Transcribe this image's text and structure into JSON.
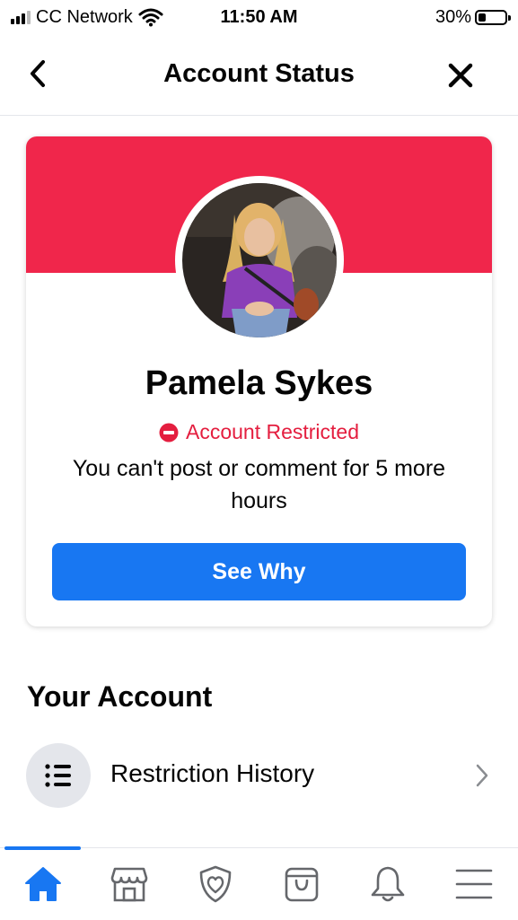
{
  "status_bar": {
    "carrier": "CC Network",
    "time": "11:50 AM",
    "battery": "30%",
    "battery_level": 0.3
  },
  "header": {
    "title": "Account Status",
    "back_icon": "chevron-left-icon",
    "close_icon": "close-icon"
  },
  "profile": {
    "name": "Pamela Sykes",
    "status_label": "Account Restricted",
    "status_icon": "no-entry-icon",
    "message": "You can't post or comment for 5 more hours",
    "button_label": "See Why",
    "banner_color": "#f0264b",
    "status_color": "#e41e3f",
    "button_color": "#1877f2"
  },
  "account": {
    "section_title": "Your Account",
    "items": [
      {
        "label": "Restriction History",
        "icon": "list-icon"
      }
    ]
  },
  "bottom_nav": {
    "items": [
      {
        "icon": "home-icon",
        "active": true
      },
      {
        "icon": "marketplace-icon",
        "active": false
      },
      {
        "icon": "dating-heart-shield-icon",
        "active": false
      },
      {
        "icon": "shopping-bag-icon",
        "active": false
      },
      {
        "icon": "bell-icon",
        "active": false
      },
      {
        "icon": "menu-icon",
        "active": false
      }
    ]
  }
}
